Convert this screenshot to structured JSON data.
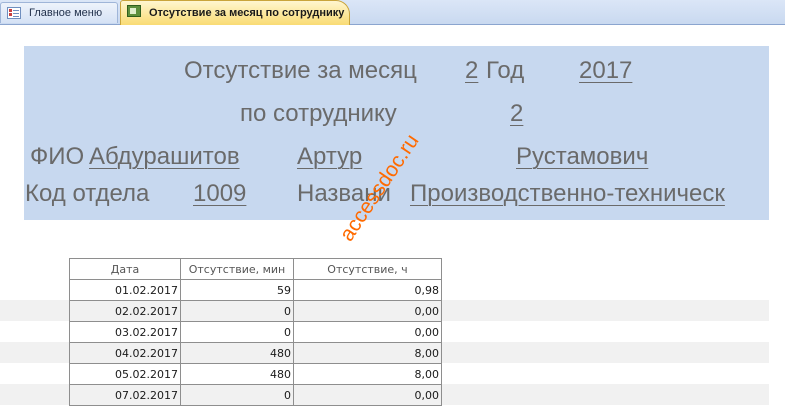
{
  "tabs": [
    {
      "label": "Главное меню",
      "icon": "table-grid-icon",
      "active": false
    },
    {
      "label": "Отсутствие за месяц по сотруднику",
      "icon": "form-icon",
      "active": true
    }
  ],
  "header": {
    "title_label": "Отсутствие за месяц",
    "month": "2",
    "year_label": "Год",
    "year": "2017",
    "employee_label": "по сотруднику",
    "employee_id": "2",
    "fio_label": "ФИО",
    "last_name": "Абдурашитов",
    "first_name": "Артур",
    "patronymic": "Рустамович",
    "dept_code_label": "Код отдела",
    "dept_code": "1009",
    "dept_name_label": "Названи",
    "dept_name": "Производственно-техническ",
    "background": "#c7d8ef"
  },
  "table": {
    "columns": [
      "Дата",
      "Отсутствие, мин",
      "Отсутствие, ч"
    ],
    "rows": [
      [
        "01.02.2017",
        "59",
        "0,98"
      ],
      [
        "02.02.2017",
        "0",
        "0,00"
      ],
      [
        "03.02.2017",
        "0",
        "0,00"
      ],
      [
        "04.02.2017",
        "480",
        "8,00"
      ],
      [
        "05.02.2017",
        "480",
        "8,00"
      ],
      [
        "07.02.2017",
        "0",
        "0,00"
      ]
    ]
  },
  "watermark": "accessdoc.ru",
  "colors": {
    "accent_tab": "#f9db74",
    "watermark": "#ff6a00",
    "stripe": "#f1f1f1"
  }
}
